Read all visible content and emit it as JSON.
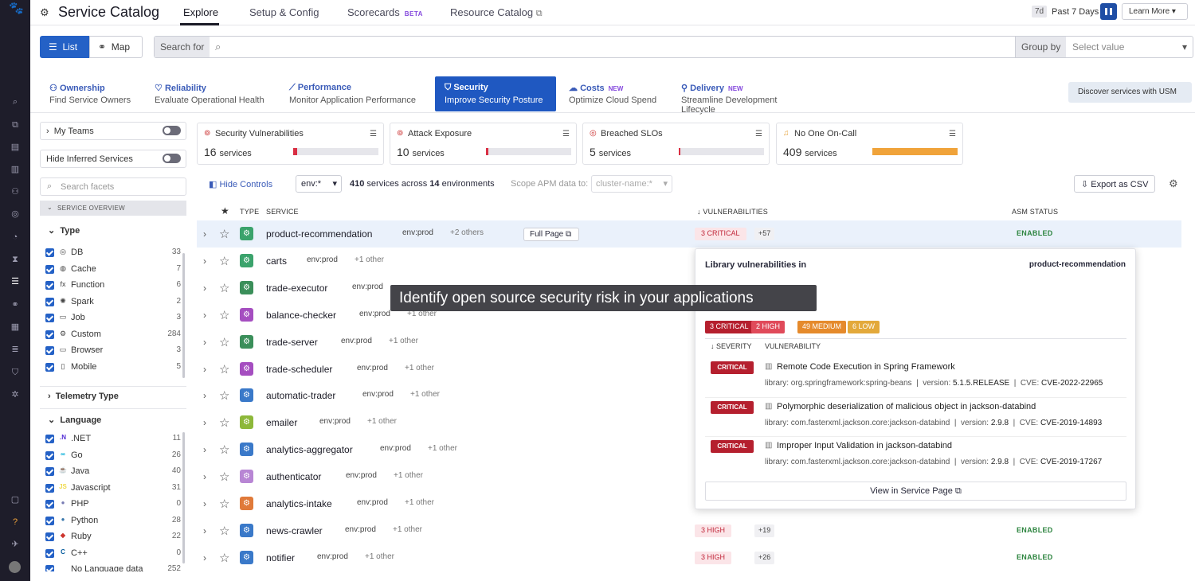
{
  "app": {
    "title": "Service Catalog"
  },
  "nav": {
    "tabs": [
      "Explore",
      "Setup & Config",
      "Scorecards",
      "Resource Catalog"
    ],
    "beta": "BETA",
    "time_pill": "7d",
    "time_label": "Past 7 Days",
    "learn_more": "Learn More"
  },
  "toolbar": {
    "list_label": "List",
    "map_label": "Map",
    "search_label": "Search for",
    "group_by_label": "Group by",
    "select_placeholder": "Select value"
  },
  "categories": [
    {
      "title": "Ownership",
      "subtitle": "Find Service Owners",
      "badge": ""
    },
    {
      "title": "Reliability",
      "subtitle": "Evaluate Operational Health",
      "badge": ""
    },
    {
      "title": "Performance",
      "subtitle": "Monitor Application Performance",
      "badge": ""
    },
    {
      "title": "Security",
      "subtitle": "Improve Security Posture",
      "badge": ""
    },
    {
      "title": "Costs",
      "subtitle": "Optimize Cloud Spend",
      "badge": "NEW"
    },
    {
      "title": "Delivery",
      "subtitle": "Streamline Development Lifecycle",
      "badge": "NEW"
    }
  ],
  "discover_label": "Discover services with USM",
  "sidebar": {
    "my_teams": "My Teams",
    "hide_inferred": "Hide Inferred Services",
    "search_facets": "Search facets",
    "service_overview": "SERVICE OVERVIEW",
    "type_heading": "Type",
    "types": [
      {
        "label": "DB",
        "count": "33",
        "icon": "◎"
      },
      {
        "label": "Cache",
        "count": "7",
        "icon": "◍"
      },
      {
        "label": "Function",
        "count": "6",
        "icon": "fx"
      },
      {
        "label": "Spark",
        "count": "2",
        "icon": "✺"
      },
      {
        "label": "Job",
        "count": "3",
        "icon": "▭"
      },
      {
        "label": "Custom",
        "count": "284",
        "icon": "⚙"
      },
      {
        "label": "Browser",
        "count": "3",
        "icon": "▭"
      },
      {
        "label": "Mobile",
        "count": "5",
        "icon": "▯"
      }
    ],
    "telemetry_heading": "Telemetry Type",
    "language_heading": "Language",
    "languages": [
      {
        "label": ".NET",
        "count": "11",
        "icon": ".N",
        "color": "#512bd4"
      },
      {
        "label": "Go",
        "count": "26",
        "icon": "∞",
        "color": "#00add8"
      },
      {
        "label": "Java",
        "count": "40",
        "icon": "☕",
        "color": "#e76f00"
      },
      {
        "label": "Javascript",
        "count": "31",
        "icon": "JS",
        "color": "#f0db4f"
      },
      {
        "label": "PHP",
        "count": "0",
        "icon": "●",
        "color": "#777bb3"
      },
      {
        "label": "Python",
        "count": "28",
        "icon": "●",
        "color": "#3776ab"
      },
      {
        "label": "Ruby",
        "count": "22",
        "icon": "◆",
        "color": "#cc342d"
      },
      {
        "label": "C++",
        "count": "0",
        "icon": "C",
        "color": "#00599c"
      },
      {
        "label": "No Language data",
        "count": "252",
        "icon": "",
        "color": "#999"
      }
    ]
  },
  "kpis": [
    {
      "title": "Security Vulnerabilities",
      "count": "16",
      "unit": "services",
      "fill": 0.05,
      "color": "#d92f43",
      "icon": "⊚"
    },
    {
      "title": "Attack Exposure",
      "count": "10",
      "unit": "services",
      "fill": 0.03,
      "color": "#d92f43",
      "icon": "⊚"
    },
    {
      "title": "Breached SLOs",
      "count": "5",
      "unit": "services",
      "fill": 0.02,
      "color": "#d92f43",
      "icon": "◎"
    },
    {
      "title": "No One On-Call",
      "count": "409",
      "unit": "services",
      "fill": 1.0,
      "color": "#f0a33a",
      "icon": "🔔"
    }
  ],
  "controls": {
    "hide_controls": "Hide Controls",
    "env": "env:*",
    "summary_a": "410",
    "summary_b": "services across",
    "summary_c": "14",
    "summary_d": "environments",
    "scope_label": "Scope APM data to:",
    "scope_value": "cluster-name:*",
    "export": "Export as CSV"
  },
  "table": {
    "headers": {
      "type": "TYPE",
      "service": "SERVICE",
      "vulns": "VULNERABILITIES",
      "asm": "ASM STATUS"
    },
    "full_page": "Full Page",
    "rows": [
      {
        "name": "product-recommendation",
        "env": "env:prod",
        "other": "+2 others",
        "type_color": "#3ba36c",
        "vuln": "3 CRITICAL",
        "plus": "+57",
        "asm": "ENABLED"
      },
      {
        "name": "carts",
        "env": "env:prod",
        "other": "+1 other",
        "type_color": "#3ba36c",
        "vuln": "",
        "plus": "",
        "asm": ""
      },
      {
        "name": "trade-executor",
        "env": "env:prod",
        "other": "",
        "type_color": "#3b8f5a",
        "vuln": "",
        "plus": "",
        "asm": ""
      },
      {
        "name": "balance-checker",
        "env": "env:prod",
        "other": "+1 other",
        "type_color": "#a54ec0",
        "vuln": "",
        "plus": "",
        "asm": ""
      },
      {
        "name": "trade-server",
        "env": "env:prod",
        "other": "+1 other",
        "type_color": "#3b8f5a",
        "vuln": "",
        "plus": "",
        "asm": ""
      },
      {
        "name": "trade-scheduler",
        "env": "env:prod",
        "other": "+1 other",
        "type_color": "#a54ec0",
        "vuln": "",
        "plus": "",
        "asm": ""
      },
      {
        "name": "automatic-trader",
        "env": "env:prod",
        "other": "+1 other",
        "type_color": "#3a79c9",
        "vuln": "",
        "plus": "",
        "asm": ""
      },
      {
        "name": "emailer",
        "env": "env:prod",
        "other": "+1 other",
        "type_color": "#8db83a",
        "vuln": "",
        "plus": "",
        "asm": ""
      },
      {
        "name": "analytics-aggregator",
        "env": "env:prod",
        "other": "+1 other",
        "type_color": "#3a79c9",
        "vuln": "",
        "plus": "",
        "asm": ""
      },
      {
        "name": "authenticator",
        "env": "env:prod",
        "other": "+1 other",
        "type_color": "#b886d4",
        "vuln": "",
        "plus": "",
        "asm": ""
      },
      {
        "name": "analytics-intake",
        "env": "env:prod",
        "other": "+1 other",
        "type_color": "#e07a3a",
        "vuln": "",
        "plus": "",
        "asm": ""
      },
      {
        "name": "news-crawler",
        "env": "env:prod",
        "other": "+1 other",
        "type_color": "#3a79c9",
        "vuln": "3 HIGH",
        "plus": "+19",
        "asm": "ENABLED"
      },
      {
        "name": "notifier",
        "env": "env:prod",
        "other": "+1 other",
        "type_color": "#3a79c9",
        "vuln": "3 HIGH",
        "plus": "+26",
        "asm": "ENABLED"
      }
    ]
  },
  "popup": {
    "title": "Library vulnerabilities in",
    "service": "product-recommendation",
    "badges": [
      {
        "label": "3 CRITICAL",
        "color": "#b51f2e"
      },
      {
        "label": "2 HIGH",
        "color": "#e04a5a"
      },
      {
        "label": "49 MEDIUM",
        "color": "#e58a2c"
      },
      {
        "label": "6 LOW",
        "color": "#e3a93b"
      }
    ],
    "col_severity": "SEVERITY",
    "col_vuln": "VULNERABILITY",
    "items": [
      {
        "severity": "CRITICAL",
        "title": "Remote Code Execution in Spring Framework",
        "library": "org.springframework:spring-beans",
        "version": "5.1.5.RELEASE",
        "cve": "CVE-2022-22965"
      },
      {
        "severity": "CRITICAL",
        "title": "Polymorphic deserialization of malicious object in jackson-databind",
        "library": "com.fasterxml.jackson.core:jackson-databind",
        "version": "2.9.8",
        "cve": "CVE-2019-14893"
      },
      {
        "severity": "CRITICAL",
        "title": "Improper Input Validation in jackson-databind",
        "library": "com.fasterxml.jackson.core:jackson-databind",
        "version": "2.9.8",
        "cve": "CVE-2019-17267"
      }
    ],
    "view_link": "View in Service Page"
  },
  "overlay": {
    "caption": "Identify open source security risk in your applications"
  }
}
